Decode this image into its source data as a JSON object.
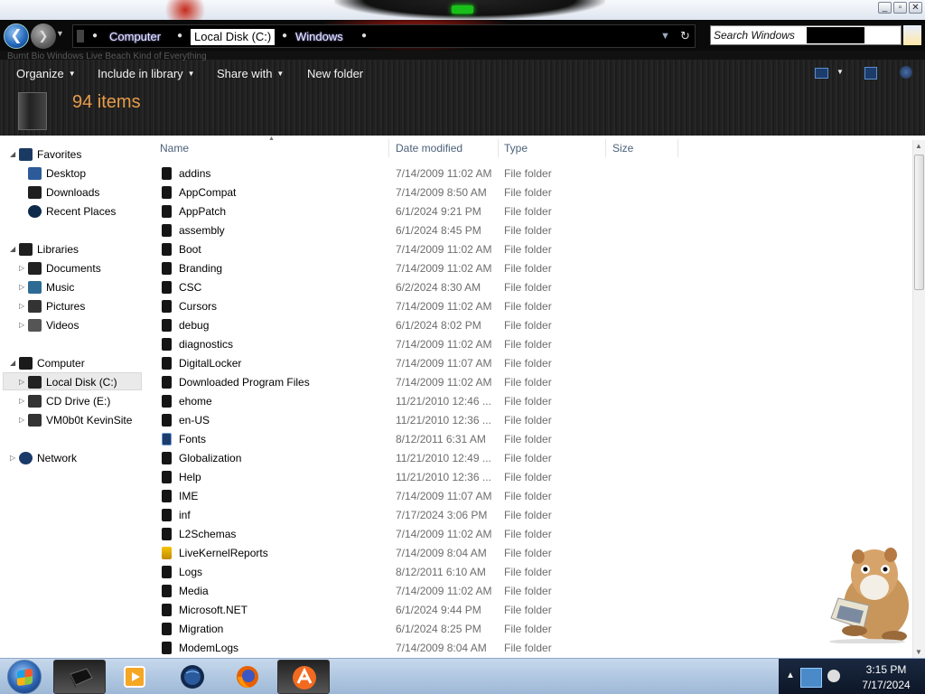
{
  "window": {
    "caption_buttons": [
      "_",
      "▫",
      "✕"
    ]
  },
  "address": {
    "crumbs": [
      "Computer",
      "Local Disk (C:)",
      "Windows"
    ],
    "search_placeholder": "Search Windows"
  },
  "toolbar": {
    "ghost_text": "Burnt Bio Windows Live Beach Kind of Everything",
    "buttons": [
      {
        "label": "Organize",
        "dropdown": true
      },
      {
        "label": "Include in library",
        "dropdown": true
      },
      {
        "label": "Share with",
        "dropdown": true
      },
      {
        "label": "New folder",
        "dropdown": false
      }
    ],
    "item_count": "94 items"
  },
  "nav": [
    {
      "label": "Favorites",
      "level": 0,
      "expander": "open",
      "icon": "star-icon",
      "color": "#1b3a63"
    },
    {
      "label": "Desktop",
      "level": 1,
      "icon": "desktop-icon",
      "color": "#2d5b9a"
    },
    {
      "label": "Downloads",
      "level": 1,
      "icon": "downloads-folder-icon",
      "color": "#1f1f1f"
    },
    {
      "label": "Recent Places",
      "level": 1,
      "icon": "recent-places-icon",
      "color": "#0d2a4a"
    },
    {
      "label": "Libraries",
      "level": 0,
      "expander": "open",
      "icon": "libraries-icon",
      "color": "#1f1f1f"
    },
    {
      "label": "Documents",
      "level": 1,
      "expander": "closed",
      "icon": "documents-icon",
      "color": "#222"
    },
    {
      "label": "Music",
      "level": 1,
      "expander": "closed",
      "icon": "music-icon",
      "color": "#2e6b94"
    },
    {
      "label": "Pictures",
      "level": 1,
      "expander": "closed",
      "icon": "pictures-icon",
      "color": "#333"
    },
    {
      "label": "Videos",
      "level": 1,
      "expander": "closed",
      "icon": "videos-icon",
      "color": "#555"
    },
    {
      "label": "Computer",
      "level": 0,
      "expander": "open",
      "icon": "computer-icon",
      "color": "#1a1a1a"
    },
    {
      "label": "Local Disk (C:)",
      "level": 1,
      "expander": "closed",
      "icon": "hard-disk-icon",
      "color": "#222",
      "selected": true
    },
    {
      "label": "CD Drive (E:)",
      "level": 1,
      "expander": "closed",
      "icon": "cd-drive-icon",
      "color": "#333"
    },
    {
      "label": "VM0b0t KevinSite",
      "level": 1,
      "expander": "closed",
      "icon": "network-drive-icon",
      "color": "#333"
    },
    {
      "label": "Network",
      "level": 0,
      "expander": "closed",
      "icon": "network-icon",
      "color": "#1a3a6a"
    }
  ],
  "columns": [
    "Name",
    "Date modified",
    "Type",
    "Size"
  ],
  "files": [
    {
      "name": "addins",
      "date": "7/14/2009 11:02 AM",
      "type": "File folder"
    },
    {
      "name": "AppCompat",
      "date": "7/14/2009 8:50 AM",
      "type": "File folder"
    },
    {
      "name": "AppPatch",
      "date": "6/1/2024 9:21 PM",
      "type": "File folder"
    },
    {
      "name": "assembly",
      "date": "6/1/2024 8:45 PM",
      "type": "File folder"
    },
    {
      "name": "Boot",
      "date": "7/14/2009 11:02 AM",
      "type": "File folder"
    },
    {
      "name": "Branding",
      "date": "7/14/2009 11:02 AM",
      "type": "File folder"
    },
    {
      "name": "CSC",
      "date": "6/2/2024 8:30 AM",
      "type": "File folder"
    },
    {
      "name": "Cursors",
      "date": "7/14/2009 11:02 AM",
      "type": "File folder"
    },
    {
      "name": "debug",
      "date": "6/1/2024 8:02 PM",
      "type": "File folder"
    },
    {
      "name": "diagnostics",
      "date": "7/14/2009 11:02 AM",
      "type": "File folder"
    },
    {
      "name": "DigitalLocker",
      "date": "7/14/2009 11:07 AM",
      "type": "File folder"
    },
    {
      "name": "Downloaded Program Files",
      "date": "7/14/2009 11:02 AM",
      "type": "File folder"
    },
    {
      "name": "ehome",
      "date": "11/21/2010 12:46 ...",
      "type": "File folder"
    },
    {
      "name": "en-US",
      "date": "11/21/2010 12:36 ...",
      "type": "File folder"
    },
    {
      "name": "Fonts",
      "date": "8/12/2011 6:31 AM",
      "type": "File folder",
      "icon": "fonts-folder-icon"
    },
    {
      "name": "Globalization",
      "date": "11/21/2010 12:49 ...",
      "type": "File folder"
    },
    {
      "name": "Help",
      "date": "11/21/2010 12:36 ...",
      "type": "File folder"
    },
    {
      "name": "IME",
      "date": "7/14/2009 11:07 AM",
      "type": "File folder"
    },
    {
      "name": "inf",
      "date": "7/17/2024 3:06 PM",
      "type": "File folder"
    },
    {
      "name": "L2Schemas",
      "date": "7/14/2009 11:02 AM",
      "type": "File folder"
    },
    {
      "name": "LiveKernelReports",
      "date": "7/14/2009 8:04 AM",
      "type": "File folder",
      "icon": "warning-folder-icon"
    },
    {
      "name": "Logs",
      "date": "8/12/2011 6:10 AM",
      "type": "File folder"
    },
    {
      "name": "Media",
      "date": "7/14/2009 11:02 AM",
      "type": "File folder"
    },
    {
      "name": "Microsoft.NET",
      "date": "6/1/2024 9:44 PM",
      "type": "File folder"
    },
    {
      "name": "Migration",
      "date": "6/1/2024 8:25 PM",
      "type": "File folder"
    },
    {
      "name": "ModemLogs",
      "date": "7/14/2009 8:04 AM",
      "type": "File folder"
    }
  ],
  "taskbar": {
    "apps": [
      {
        "icon": "explorer-app-icon",
        "active": true
      },
      {
        "icon": "media-player-app-icon",
        "active": false
      },
      {
        "icon": "globe-app-icon",
        "active": false
      },
      {
        "icon": "firefox-app-icon",
        "active": false
      },
      {
        "icon": "avast-app-icon",
        "active": true
      }
    ],
    "time": "3:15 PM",
    "date": "7/17/2024"
  },
  "colors": {
    "item_count": "#e79c4a",
    "folder_icon": "#151515",
    "column_header_text": "#4c607a",
    "secondary_text": "#6d6d6d"
  }
}
